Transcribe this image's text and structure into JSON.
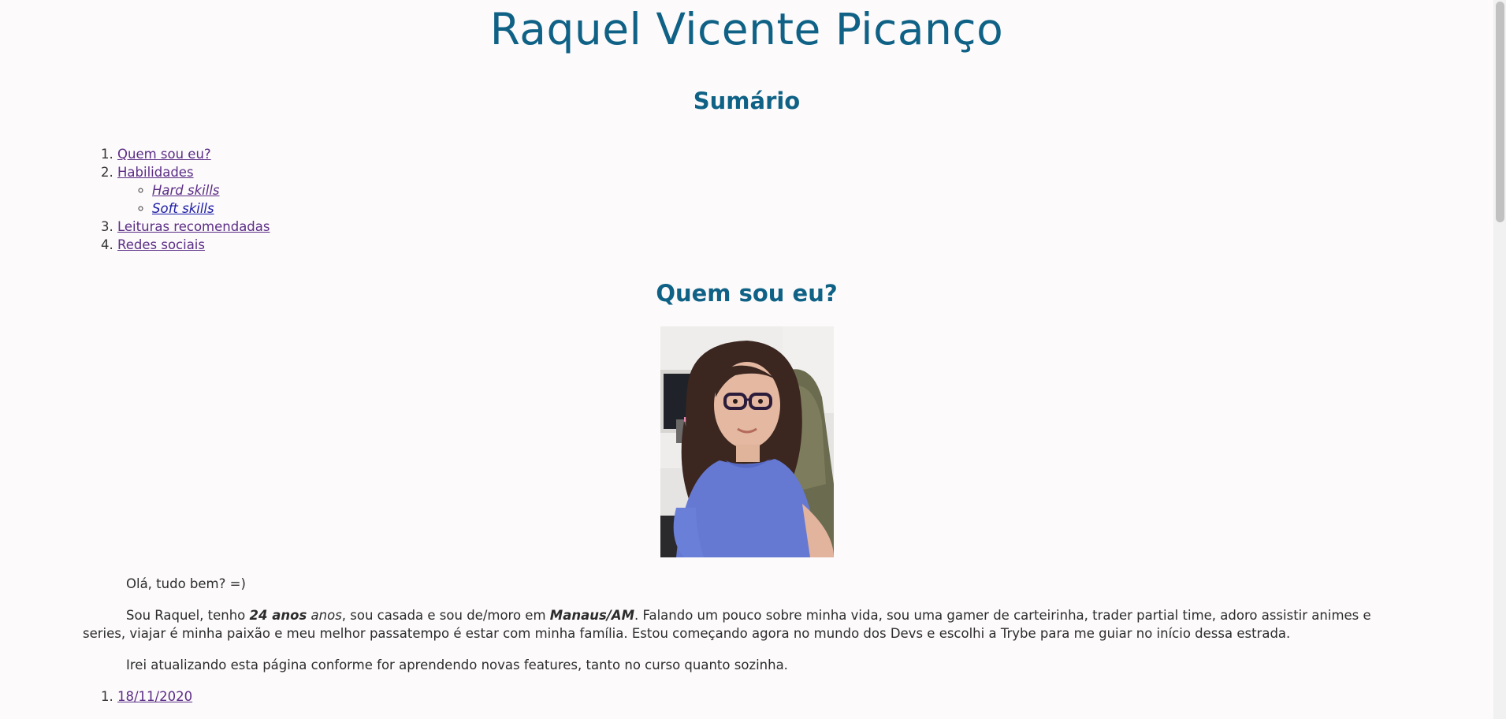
{
  "page": {
    "title": "Raquel Vicente Picanço"
  },
  "summary": {
    "heading": "Sumário",
    "items": [
      {
        "label": "Quem sou eu?"
      },
      {
        "label": "Habilidades",
        "subitems": [
          {
            "label": "Hard skills"
          },
          {
            "label": "Soft skills"
          }
        ]
      },
      {
        "label": "Leituras recomendadas"
      },
      {
        "label": "Redes sociais"
      }
    ]
  },
  "about": {
    "heading": "Quem sou eu?",
    "photo_icon": "profile-photo",
    "greeting": "Olá, tudo bem? =)",
    "intro_1": "Sou Raquel, tenho ",
    "age": "24 anos",
    "intro_2": " anos",
    "intro_3": ", sou casada e sou de/moro em ",
    "city": "Manaus/AM",
    "intro_4": ". Falando um pouco sobre minha vida, sou uma gamer de carteirinha, trader partial time, adoro assistir animes e series, viajar é minha paixão e meu melhor passatempo é estar com minha família. Estou começando agora no mundo dos Devs e escolhi a Trybe para me guiar no início dessa estrada.",
    "update_note": "Irei atualizando esta página conforme for aprendendo novas features, tanto no curso quanto sozinha."
  },
  "updates": [
    {
      "date": "18/11/2020"
    }
  ],
  "colors": {
    "heading": "#0f6286",
    "link_visited": "#5b2d86",
    "link": "#1a1aa6",
    "background": "#fcfafb"
  }
}
